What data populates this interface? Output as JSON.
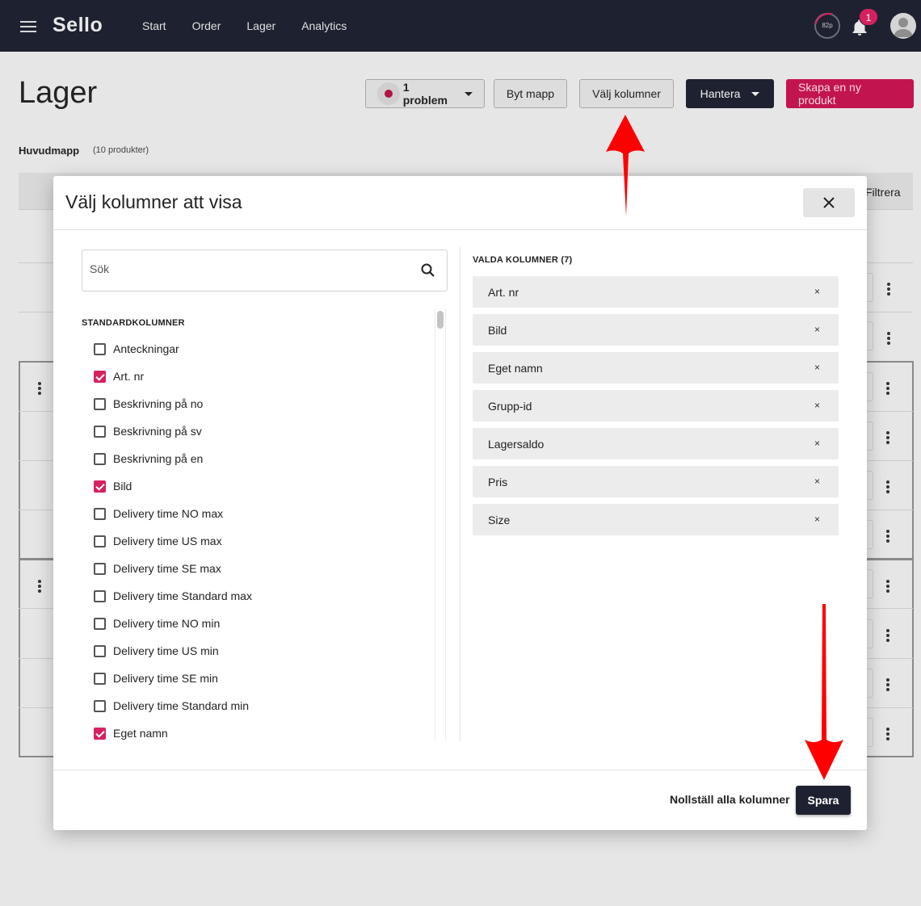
{
  "app": {
    "logo": "Sello",
    "nav": [
      "Start",
      "Order",
      "Lager",
      "Analytics"
    ],
    "progress_label": "82p",
    "notification_count": "1"
  },
  "page": {
    "title": "Lager",
    "buttons": {
      "problem": "1 problem",
      "switch_folder": "Byt mapp",
      "choose_columns": "Välj kolumner",
      "manage": "Hantera",
      "create_product": "Skapa en ny produkt"
    },
    "folder_name": "Huvudmapp",
    "folder_count": "(10 produkter)",
    "filter_label": "Filtrera"
  },
  "modal": {
    "title": "Välj kolumner att visa",
    "search_placeholder": "Sök",
    "standard_heading": "STANDARDKOLUMNER",
    "columns": [
      {
        "label": "Anteckningar",
        "checked": false
      },
      {
        "label": "Art. nr",
        "checked": true
      },
      {
        "label": "Beskrivning på no",
        "checked": false
      },
      {
        "label": "Beskrivning på sv",
        "checked": false
      },
      {
        "label": "Beskrivning på en",
        "checked": false
      },
      {
        "label": "Bild",
        "checked": true
      },
      {
        "label": "Delivery time NO max",
        "checked": false
      },
      {
        "label": "Delivery time US max",
        "checked": false
      },
      {
        "label": "Delivery time SE max",
        "checked": false
      },
      {
        "label": "Delivery time Standard max",
        "checked": false
      },
      {
        "label": "Delivery time NO min",
        "checked": false
      },
      {
        "label": "Delivery time US min",
        "checked": false
      },
      {
        "label": "Delivery time SE min",
        "checked": false
      },
      {
        "label": "Delivery time Standard min",
        "checked": false
      },
      {
        "label": "Eget namn",
        "checked": true
      }
    ],
    "selected_heading": "VALDA KOLUMNER (7)",
    "selected": [
      "Art. nr",
      "Bild",
      "Eget namn",
      "Grupp-id",
      "Lagersaldo",
      "Pris",
      "Size"
    ],
    "remove_glyph": "×",
    "reset_label": "Nollställ alla kolumner",
    "save_label": "Spara"
  },
  "colors": {
    "topbar": "#1e2230",
    "accent": "#d6215f",
    "annotation_arrow": "#ff0000"
  }
}
